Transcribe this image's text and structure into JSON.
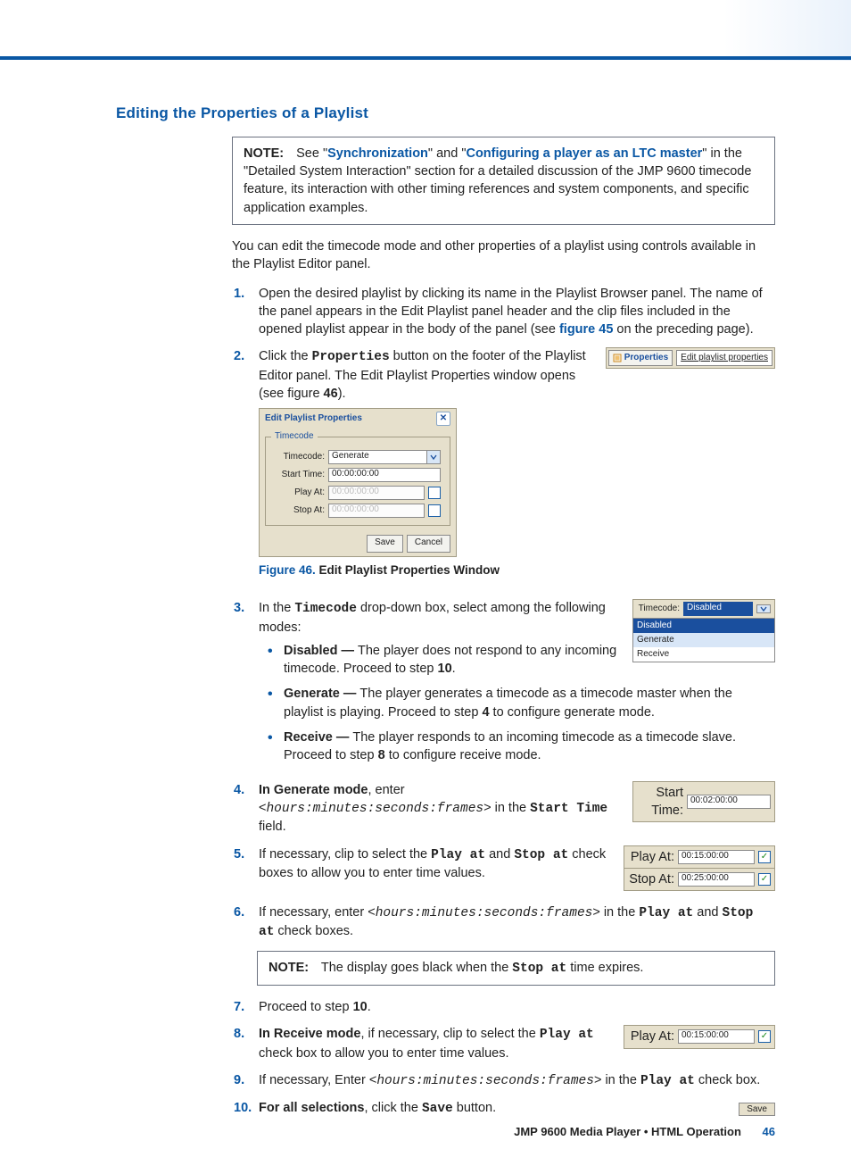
{
  "heading": "Editing the Properties of a Playlist",
  "note1": {
    "label": "NOTE:",
    "pre": "See \"",
    "link1": "Synchronization",
    "mid1": "\" and \"",
    "link2": "Configuring a player as an LTC master",
    "post": "\" in the \"Detailed System Interaction\" section for a detailed discussion of the JMP 9600 timecode feature, its interaction with other timing references and system components, and specific application examples."
  },
  "intro": "You can edit the timecode mode and other properties of a playlist using controls available in the Playlist Editor panel.",
  "steps": {
    "s1a": "Open the desired playlist by clicking its name in the Playlist Browser panel. The name of the panel appears in the Edit Playlist panel header and the clip files included in the opened playlist appear in the body of the panel (see ",
    "s1_link": "figure 45",
    "s1b": " on the preceding page).",
    "s2a": "Click the ",
    "s2_code": "Properties",
    "s2b": " button on the footer of the Playlist Editor panel. The Edit Playlist Properties window opens (see figure ",
    "s2_num": "46",
    "s2c": ").",
    "s3a": "In the ",
    "s3_code": "Timecode",
    "s3b": " drop-down box, select among the following modes:",
    "s3_disabled_hdr": "Disabled — ",
    "s3_disabled": "The player does not respond to any incoming timecode. Proceed to step ",
    "s3_disabled_step": "10",
    "s3_disabled_end": ".",
    "s3_generate_hdr": "Generate — ",
    "s3_generate": "The player generates a timecode as a timecode master when the playlist is playing. Proceed to step ",
    "s3_generate_step": "4",
    "s3_generate_end": " to configure generate mode.",
    "s3_receive_hdr": "Receive — ",
    "s3_receive": "The player responds to an incoming timecode as a timecode slave. Proceed to step ",
    "s3_receive_step": "8",
    "s3_receive_end": " to configure receive mode.",
    "s4_hdr": "In Generate mode",
    "s4a": ", enter <",
    "s4_code": "hours:minutes:seconds:frames",
    "s4b": "> in the ",
    "s4_field": "Start Time",
    "s4c": " field.",
    "s5a": "If necessary, clip to select the ",
    "s5_play": "Play at",
    "s5_and": " and ",
    "s5_stop": "Stop at",
    "s5b": " check boxes to allow you to enter time values.",
    "s6a": "If necessary, enter <",
    "s6_code": "hours:minutes:seconds:frames",
    "s6b": "> in the ",
    "s6_play": "Play at",
    "s6_and": " and ",
    "s6_stop": "Stop at",
    "s6c": " check boxes.",
    "s7a": "Proceed to step ",
    "s7_num": "10",
    "s7b": ".",
    "s8_hdr": "In Receive mode",
    "s8a": ", if necessary, clip to select the ",
    "s8_play": "Play at",
    "s8b": " check box to allow you to enter time values.",
    "s9a": "If necessary, Enter <",
    "s9_code": "hours:minutes:seconds:frames",
    "s9b": "> in the ",
    "s9_play": "Play at",
    "s9c": " check box.",
    "s10_hdr": "For all selections",
    "s10a": ", click the ",
    "s10_save": "Save",
    "s10b": " button."
  },
  "note2": {
    "label": "NOTE:",
    "pre": "The display goes black when the ",
    "code": "Stop at",
    "post": " time expires."
  },
  "fig46": {
    "title": "Edit Playlist Properties",
    "legend": "Timecode",
    "labels": {
      "timecode": "Timecode:",
      "start": "Start Time:",
      "play": "Play At:",
      "stop": "Stop At:"
    },
    "values": {
      "timecode": "Generate",
      "start": "00:00:00:00",
      "play": "00:00:00:00",
      "stop": "00:00:00:00"
    },
    "save": "Save",
    "cancel": "Cancel",
    "caption_no": "Figure 46. ",
    "caption_txt": "Edit Playlist Properties Window"
  },
  "props_strip": {
    "btn": "Properties",
    "link": "Edit playlist properties"
  },
  "tc_dropdown": {
    "label": "Timecode:",
    "value": "Disabled",
    "options": [
      "Disabled",
      "Generate",
      "Receive"
    ]
  },
  "rfields": {
    "start": {
      "label": "Start Time:",
      "value": "00:02:00:00"
    },
    "play": {
      "label": "Play At:",
      "value": "00:15:00:00"
    },
    "stop": {
      "label": "Stop At:",
      "value": "00:25:00:00"
    },
    "play8": {
      "label": "Play At:",
      "value": "00:15:00:00"
    }
  },
  "save_btn": "Save",
  "footer": {
    "title": "JMP 9600 Media Player • HTML Operation",
    "page": "46"
  }
}
